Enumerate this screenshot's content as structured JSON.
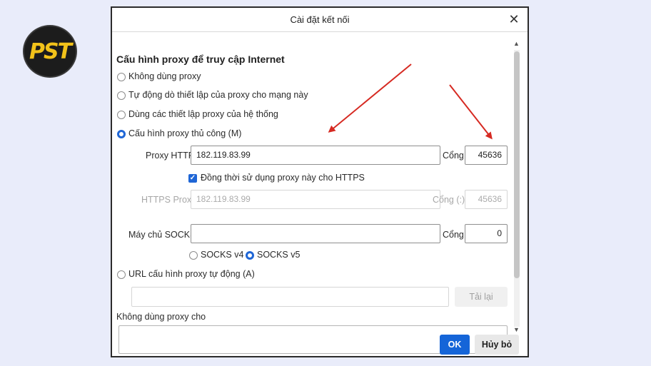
{
  "logo": {
    "text": "PST"
  },
  "dialog": {
    "title": "Cài đặt kết nối",
    "section_heading": "Cấu hình proxy để truy cập Internet",
    "options": {
      "no_proxy": "Không dùng proxy",
      "auto_detect": "Tự động dò thiết lập của proxy cho mạng này",
      "system": "Dùng các thiết lập proxy của hệ thống",
      "manual": "Cấu hình proxy thủ công (M)",
      "auto_url": "URL cấu hình proxy tự động (A)"
    },
    "selected_option": "manual",
    "http_proxy": {
      "label": "Proxy HTTP",
      "value": "182.119.83.99",
      "port_label": "Cổng",
      "port": "45636"
    },
    "also_https": {
      "label": "Đồng thời sử dụng proxy này cho HTTPS",
      "checked": true
    },
    "https_proxy": {
      "label": "HTTPS Proxy",
      "value": "182.119.83.99",
      "port_label": "Cổng (:)",
      "port": "45636"
    },
    "socks": {
      "label": "Máy chủ SOCKS",
      "value": "",
      "port_label": "Cổng",
      "port": "0",
      "v4": "SOCKS v4",
      "v5": "SOCKS v5",
      "selected": "v5"
    },
    "auto_url_value": "",
    "reload_label": "Tải lại",
    "no_proxy_for_label": "Không dùng proxy cho",
    "ok_label": "OK",
    "cancel_label": "Hủy bỏ"
  },
  "colors": {
    "accent": "#1565d8",
    "annotation_arrow": "#d62a22"
  }
}
